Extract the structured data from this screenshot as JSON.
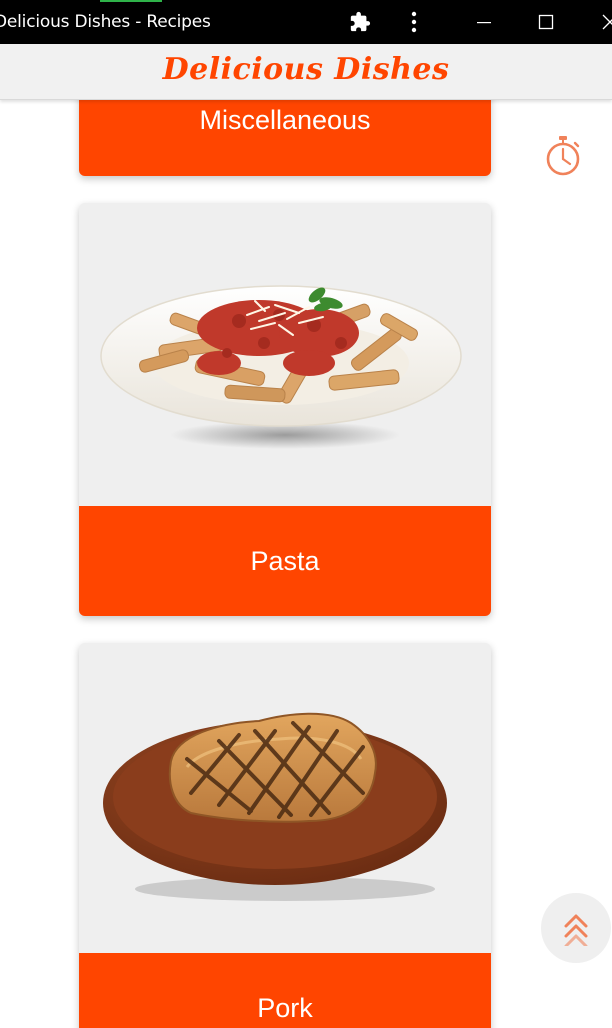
{
  "window": {
    "title": "Delicious Dishes - Recipes",
    "accent_color": "#2fb34a"
  },
  "header": {
    "brand": "Delicious Dishes",
    "brand_color": "#ff4500"
  },
  "categories": [
    {
      "label": "Miscellaneous",
      "image": "none"
    },
    {
      "label": "Pasta",
      "image": "penne-pasta-plate"
    },
    {
      "label": "Pork",
      "image": "grilled-pork-chop-board"
    }
  ],
  "icons": {
    "extensions": "puzzle-icon",
    "menu": "more-vertical-icon",
    "minimize": "minimize-icon",
    "maximize": "maximize-icon",
    "close": "close-icon",
    "timer": "stopwatch-icon",
    "scroll_top": "double-chevron-up-icon"
  },
  "colors": {
    "accent": "#ff4500",
    "card_bg": "#efefef"
  }
}
